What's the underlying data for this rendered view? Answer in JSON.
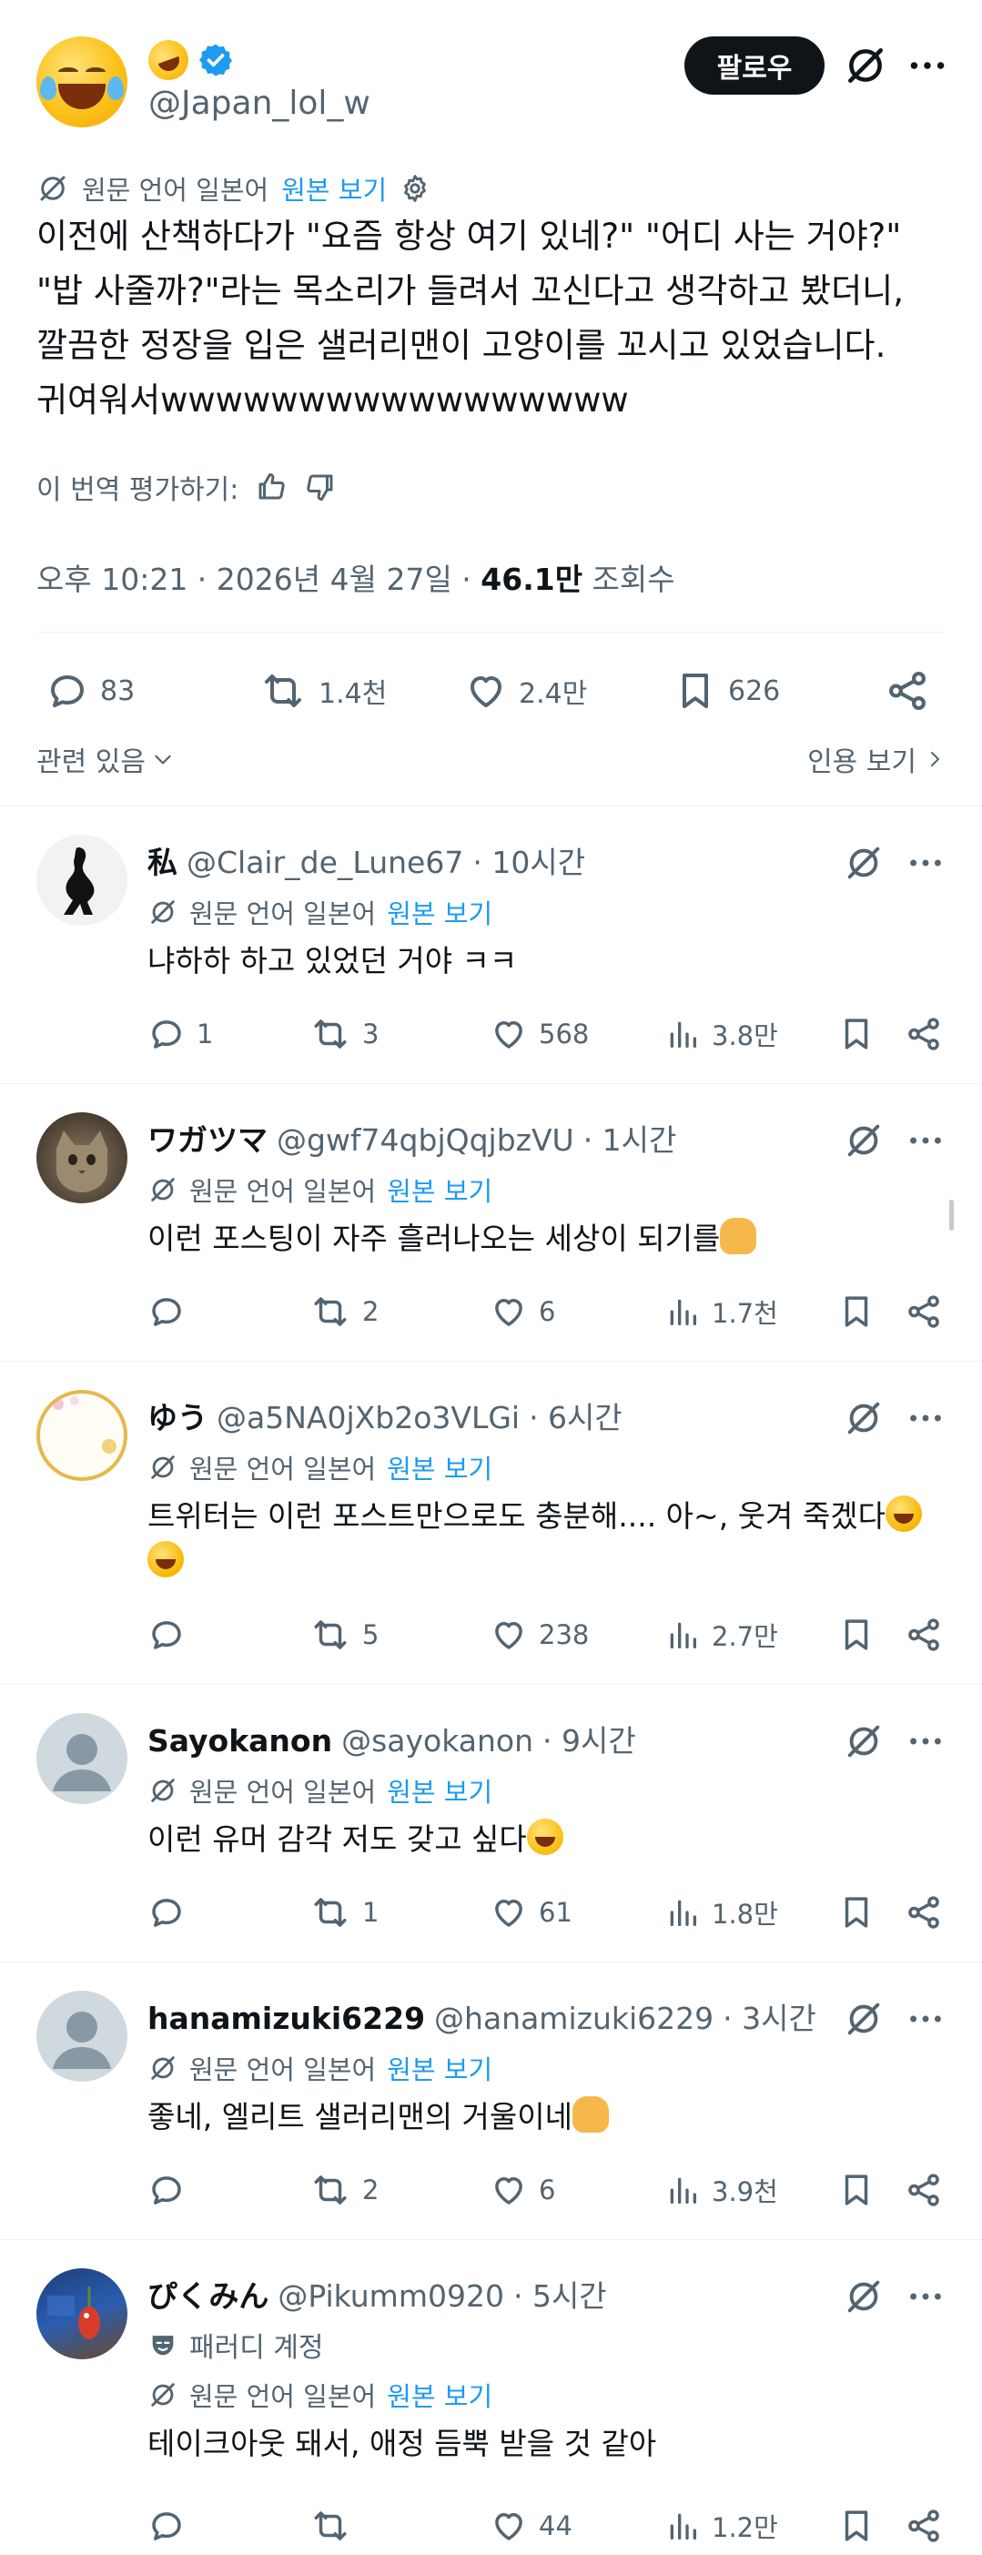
{
  "post": {
    "handle": "@Japan_lol_w",
    "follow_label": "팔로우",
    "translate_prefix": "원문 언어 일본어",
    "translate_link": "원본 보기",
    "text_lines": [
      "이전에 산책하다가 \"요즘 항상 여기 있네?\" \"어디 사는 거야?\"",
      "\"밥 사줄까?\"라는 목소리가 들려서 꼬신다고 생각하고 봤더니,",
      "깔끔한 정장을 입은 샐러리맨이 고양이를 꼬시고 있었습니다.",
      "귀여워서wwwwwwwwwwwwwwwww"
    ],
    "rate_label": "이 번역 평가하기:",
    "meta_time": "오후 10:21 · 2026년 4월 27일 · ",
    "meta_views": "46.1만",
    "meta_views_label": " 조회수",
    "stats": {
      "replies": "83",
      "reposts": "1.4천",
      "likes": "2.4만",
      "bookmarks": "626"
    },
    "related_label": "관련 있음",
    "quotes_label": "인용 보기"
  },
  "replies": [
    {
      "name": "私",
      "handle": "@Clair_de_Lune67",
      "time": "· 10시간",
      "translate_prefix": "원문 언어 일본어",
      "translate_link": "원본 보기",
      "text": "냐하하 하고 있었던 거야 ㅋㅋ",
      "replies": "1",
      "reposts": "3",
      "likes": "568",
      "views": "3.8만"
    },
    {
      "name": "ワガツマ",
      "handle": "@gwf74qbjQqjbzVU",
      "time": "· 1시간",
      "translate_prefix": "원문 언어 일본어",
      "translate_link": "원본 보기",
      "text": "이런 포스팅이 자주 흘러나오는 세상이 되기를",
      "replies": "",
      "reposts": "2",
      "likes": "6",
      "views": "1.7천"
    },
    {
      "name": "ゆう",
      "handle": "@a5NA0jXb2o3VLGi",
      "time": "· 6시간",
      "translate_prefix": "원문 언어 일본어",
      "translate_link": "원본 보기",
      "text": "트위터는 이런 포스트만으로도 충분해.... 아~, 웃겨 죽겠다",
      "replies": "",
      "reposts": "5",
      "likes": "238",
      "views": "2.7만"
    },
    {
      "name": "Sayokanon",
      "handle": "@sayokanon",
      "time": "· 9시간",
      "translate_prefix": "원문 언어 일본어",
      "translate_link": "원본 보기",
      "text": "이런 유머 감각 저도 갖고 싶다",
      "replies": "",
      "reposts": "1",
      "likes": "61",
      "views": "1.8만"
    },
    {
      "name": "hanamizuki6229",
      "handle": "@hanamizuki6229",
      "time": "· 3시간",
      "translate_prefix": "원문 언어 일본어",
      "translate_link": "원본 보기",
      "text": "좋네, 엘리트 샐러리맨의 거울이네",
      "replies": "",
      "reposts": "2",
      "likes": "6",
      "views": "3.9천"
    },
    {
      "name": "ぴくみん",
      "handle": "@Pikumm0920",
      "time": "· 5시간",
      "parody": "패러디 계정",
      "translate_prefix": "원문 언어 일본어",
      "translate_link": "원본 보기",
      "text": "테이크아웃 돼서, 애정 듬뿍 받을 것 같아",
      "replies": "",
      "reposts": "",
      "likes": "44",
      "views": "1.2만"
    }
  ],
  "icons": {
    "verified": "verified-badge-icon",
    "grok": "grok-icon",
    "more": "more-icon",
    "translate": "translate-icon",
    "settings": "gear-icon",
    "thumbs_up": "thumbs-up-icon",
    "thumbs_down": "thumbs-down-icon",
    "reply": "reply-icon",
    "repost": "repost-icon",
    "like": "heart-icon",
    "bookmark": "bookmark-icon",
    "views": "views-icon",
    "share": "share-icon"
  },
  "colors": {
    "link": "#1d9bf0",
    "text": "#0f1419",
    "muted": "#536471",
    "button": "#0f1419"
  }
}
